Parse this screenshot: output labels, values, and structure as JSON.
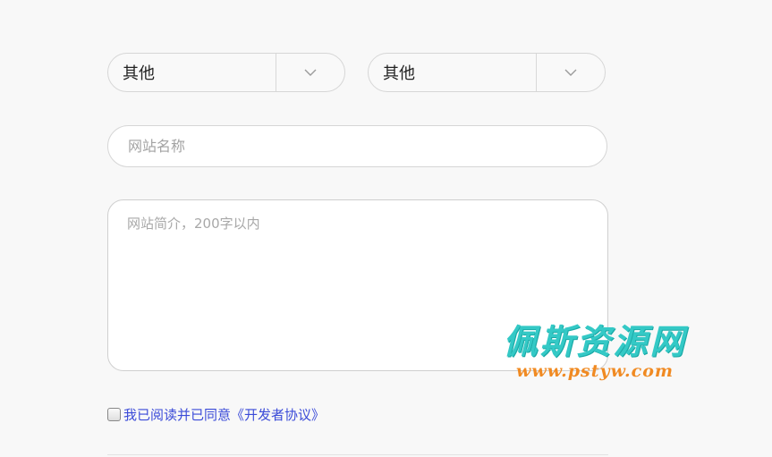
{
  "selects": [
    {
      "value": "其他",
      "icon": "chevron-down-icon"
    },
    {
      "value": "其他",
      "icon": "chevron-down-icon"
    }
  ],
  "name_field": {
    "placeholder": "网站名称",
    "value": ""
  },
  "description_field": {
    "placeholder": "网站简介，200字以内",
    "value": ""
  },
  "agreement": {
    "text": "我已阅读并已同意",
    "link_label": "《开发者协议》",
    "checked": false
  },
  "watermark": {
    "title": "佩斯资源网",
    "url": "www.pstyw.com"
  },
  "colors": {
    "link": "#3b4bd8",
    "watermark_title": "#34c9c6",
    "watermark_url": "#f08a22",
    "border": "#d6d6d6"
  }
}
